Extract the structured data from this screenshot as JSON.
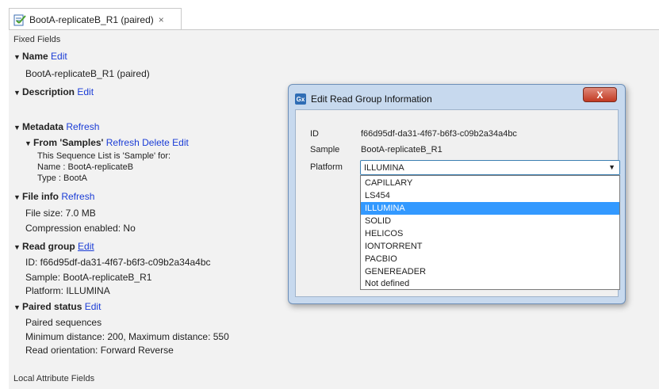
{
  "tab": {
    "title": "BootA-replicateB_R1 (paired)",
    "close": "×"
  },
  "fixed_fields_header": "Fixed Fields",
  "name": {
    "label": "Name",
    "edit": "Edit",
    "value": "BootA-replicateB_R1 (paired)"
  },
  "description": {
    "label": "Description",
    "edit": "Edit"
  },
  "metadata": {
    "label": "Metadata",
    "refresh": "Refresh",
    "from_samples": {
      "label": "From 'Samples'",
      "refresh": "Refresh",
      "delete": "Delete",
      "edit": "Edit",
      "lines": [
        "This Sequence List is 'Sample' for:",
        "Name : BootA-replicateB",
        "Type : BootA"
      ]
    }
  },
  "file_info": {
    "label": "File info",
    "refresh": "Refresh",
    "lines": [
      "File size: 7.0 MB",
      "Compression enabled: No"
    ]
  },
  "read_group": {
    "label": "Read group",
    "edit": "Edit",
    "lines": [
      "ID: f66d95df-da31-4f67-b6f3-c09b2a34a4bc",
      "Sample: BootA-replicateB_R1",
      "Platform: ILLUMINA"
    ]
  },
  "paired_status": {
    "label": "Paired status",
    "edit": "Edit",
    "lines": [
      "Paired sequences",
      "Minimum distance: 200, Maximum distance: 550",
      "Read orientation: Forward Reverse"
    ]
  },
  "local_attribute_fields": "Local Attribute Fields",
  "dialog": {
    "title": "Edit Read Group Information",
    "app_icon": "Gx",
    "close": "X",
    "id_label": "ID",
    "id_value": "f66d95df-da31-4f67-b6f3-c09b2a34a4bc",
    "sample_label": "Sample",
    "sample_value": "BootA-replicateB_R1",
    "platform_label": "Platform",
    "platform_value": "ILLUMINA",
    "options": [
      "CAPILLARY",
      "LS454",
      "ILLUMINA",
      "SOLID",
      "HELICOS",
      "IONTORRENT",
      "PACBIO",
      "GENEREADER",
      "Not defined"
    ],
    "selected_option": "ILLUMINA"
  },
  "colors": {
    "link": "#1a3cd6",
    "selection": "#3399ff",
    "panel_bg": "#f2f2f2",
    "dialog_frame": "#c7d9ee"
  }
}
